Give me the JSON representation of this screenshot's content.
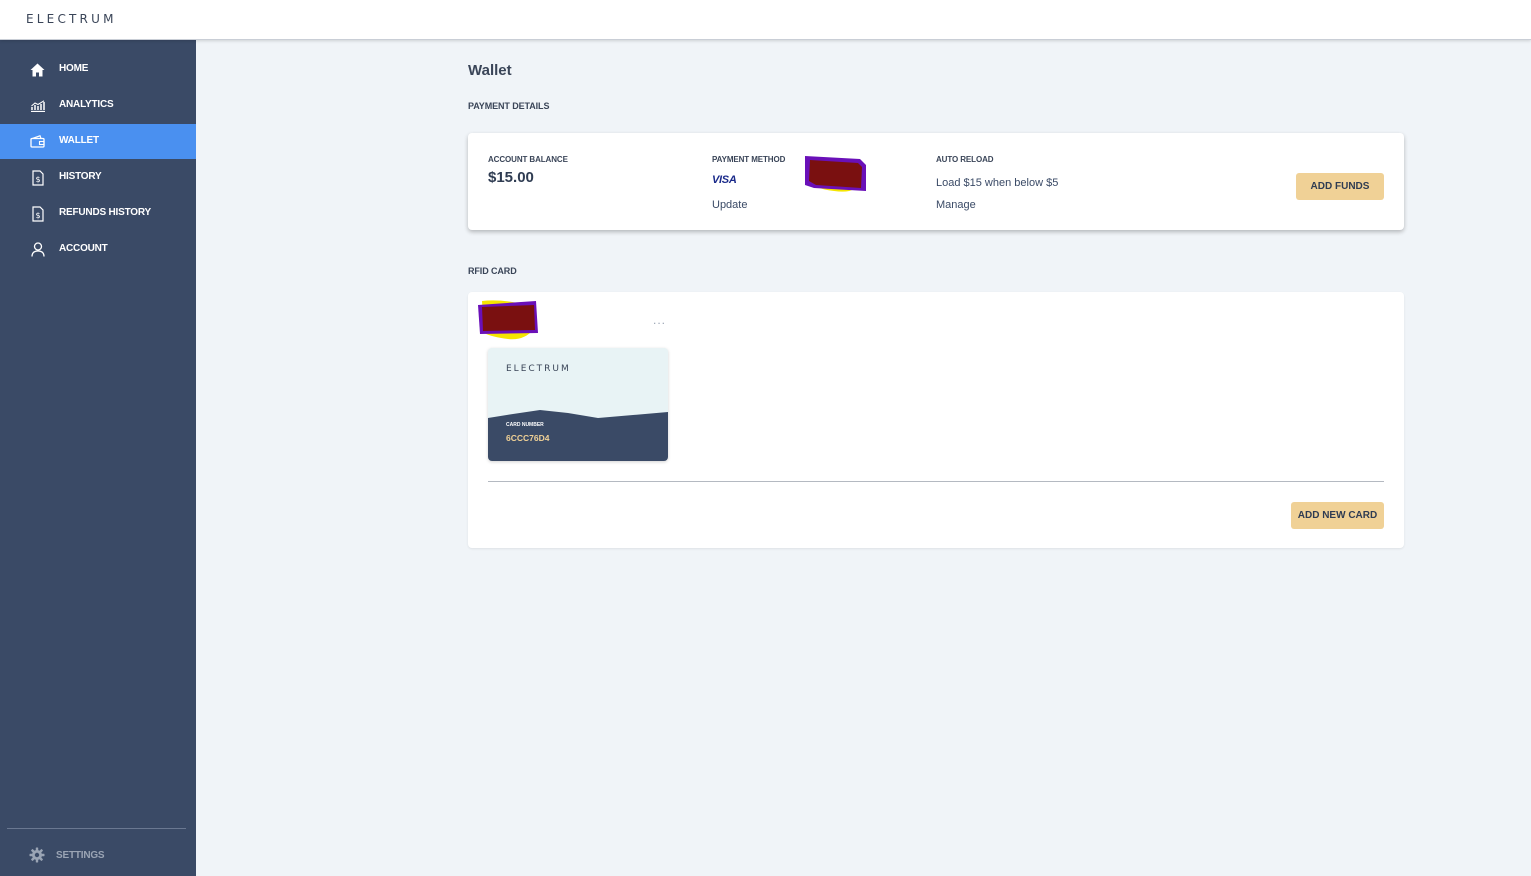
{
  "app": {
    "brand": "ELECTRUM"
  },
  "sidebar": {
    "items": [
      {
        "label": "HOME",
        "icon": "home-icon",
        "active": false
      },
      {
        "label": "ANALYTICS",
        "icon": "analytics-icon",
        "active": false
      },
      {
        "label": "WALLET",
        "icon": "wallet-icon",
        "active": true
      },
      {
        "label": "HISTORY",
        "icon": "receipt-icon",
        "active": false
      },
      {
        "label": "REFUNDS HISTORY",
        "icon": "receipt-icon",
        "active": false
      },
      {
        "label": "ACCOUNT",
        "icon": "user-icon",
        "active": false
      }
    ],
    "settings_label": "SETTINGS"
  },
  "page": {
    "title": "Wallet"
  },
  "payment": {
    "section_label": "PAYMENT DETAILS",
    "balance_label": "ACCOUNT BALANCE",
    "balance_value": "$15.00",
    "method_label": "PAYMENT METHOD",
    "method_brand": "VISA",
    "update_label": "Update",
    "auto_reload_label": "AUTO RELOAD",
    "auto_reload_text": "Load $15 when below $5",
    "manage_label": "Manage",
    "add_funds_label": "ADD FUNDS"
  },
  "rfid": {
    "section_label": "RFID CARD",
    "menu_dots": "...",
    "card_brand": "ELECTRUM",
    "card_number_label": "CARD NUMBER",
    "card_number": "6CCC76D4",
    "add_card_label": "ADD NEW CARD"
  },
  "colors": {
    "sidebar_bg": "#3a4a66",
    "active_item": "#4a90f0",
    "button_bg": "#f0d196",
    "page_bg": "#f0f4f8",
    "card_number": "#f0d196"
  }
}
